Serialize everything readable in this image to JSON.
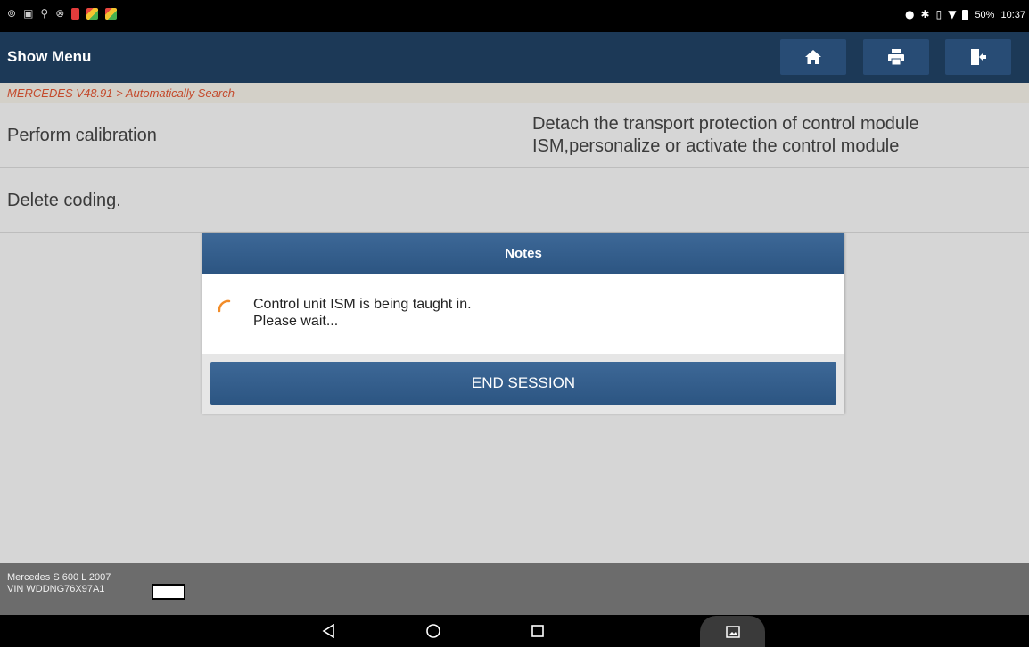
{
  "status_bar": {
    "battery": "50%",
    "time": "10:37"
  },
  "header": {
    "title": "Show Menu",
    "icons": [
      "home-icon",
      "print-icon",
      "exit-icon"
    ]
  },
  "breadcrumb": "MERCEDES V48.91 > Automatically Search",
  "rows": [
    {
      "function": "Perform calibration",
      "description": "Detach the transport protection of control module ISM,personalize or activate the control module"
    },
    {
      "function": "Delete coding.",
      "description": ""
    }
  ],
  "dialog": {
    "title": "Notes",
    "message_line1": "Control unit ISM is being taught in.",
    "message_line2": "Please wait...",
    "button": "END SESSION"
  },
  "footer": {
    "vehicle": "Mercedes S 600 L 2007",
    "vin": "VIN WDDNG76X97A1"
  },
  "colors": {
    "header_bg": "#1c3957",
    "accent_blue": "#2c5582",
    "breadcrumb_text": "#c44a2c",
    "spinner": "#f28c28"
  }
}
